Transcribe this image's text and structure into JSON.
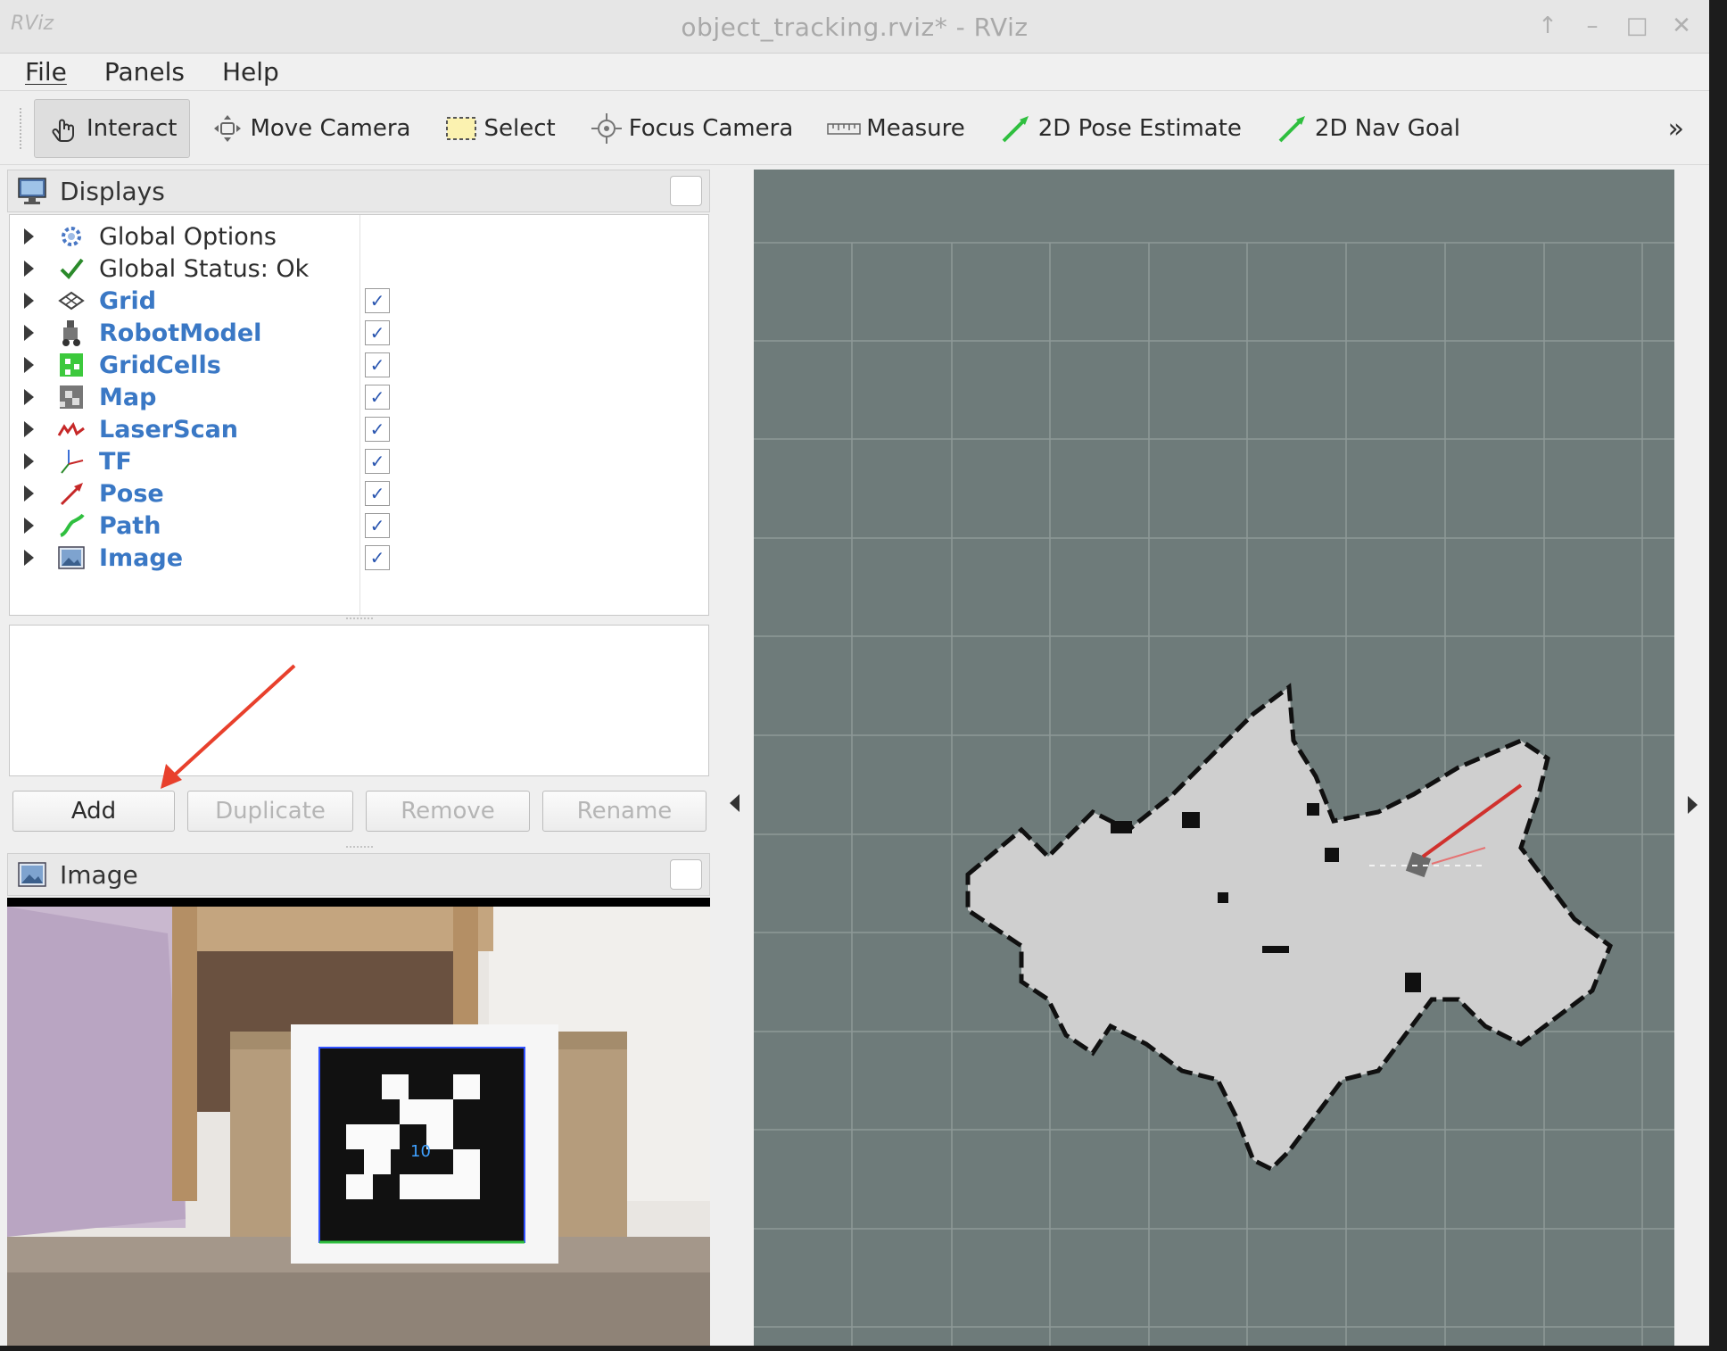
{
  "window": {
    "app_logo": "RViz",
    "title": "object_tracking.rviz* - RViz",
    "controls": [
      "↑",
      "–",
      "□",
      "✕"
    ]
  },
  "menu": [
    "File",
    "Panels",
    "Help"
  ],
  "toolbar": {
    "tools": [
      {
        "label": "Interact",
        "icon": "hand-pointer-icon",
        "active": true
      },
      {
        "label": "Move Camera",
        "icon": "move-camera-icon",
        "active": false
      },
      {
        "label": "Select",
        "icon": "select-rect-icon",
        "active": false
      },
      {
        "label": "Focus Camera",
        "icon": "focus-camera-icon",
        "active": false
      },
      {
        "label": "Measure",
        "icon": "ruler-icon",
        "active": false
      },
      {
        "label": "2D Pose Estimate",
        "icon": "green-arrow-icon",
        "active": false
      },
      {
        "label": "2D Nav Goal",
        "icon": "green-arrow-icon",
        "active": false
      }
    ],
    "more": "»"
  },
  "displays_panel": {
    "title": "Displays",
    "items": [
      {
        "label": "Global Options",
        "icon": "gear-icon",
        "checked": null,
        "bold": false
      },
      {
        "label": "Global Status: Ok",
        "icon": "check-icon",
        "checked": null,
        "bold": false
      },
      {
        "label": "Grid",
        "icon": "grid-icon",
        "checked": true,
        "bold": true
      },
      {
        "label": "RobotModel",
        "icon": "robot-icon",
        "checked": true,
        "bold": true
      },
      {
        "label": "GridCells",
        "icon": "gridcells-icon",
        "checked": true,
        "bold": true
      },
      {
        "label": "Map",
        "icon": "map-icon",
        "checked": true,
        "bold": true
      },
      {
        "label": "LaserScan",
        "icon": "laserscan-icon",
        "checked": true,
        "bold": true
      },
      {
        "label": "TF",
        "icon": "tf-axes-icon",
        "checked": true,
        "bold": true
      },
      {
        "label": "Pose",
        "icon": "pose-arrow-icon",
        "checked": true,
        "bold": true
      },
      {
        "label": "Path",
        "icon": "path-icon",
        "checked": true,
        "bold": true
      },
      {
        "label": "Image",
        "icon": "image-icon",
        "checked": true,
        "bold": true
      }
    ],
    "check_glyph": "✓"
  },
  "buttons": {
    "add": "Add",
    "duplicate": "Duplicate",
    "remove": "Remove",
    "rename": "Rename"
  },
  "image_panel": {
    "title": "Image",
    "marker_id": "10"
  },
  "colors": {
    "link_blue": "#3a78c5",
    "render_bg": "#6e7b7a",
    "map_free": "#cfcfcf",
    "annotation_red": "#e8402c"
  }
}
